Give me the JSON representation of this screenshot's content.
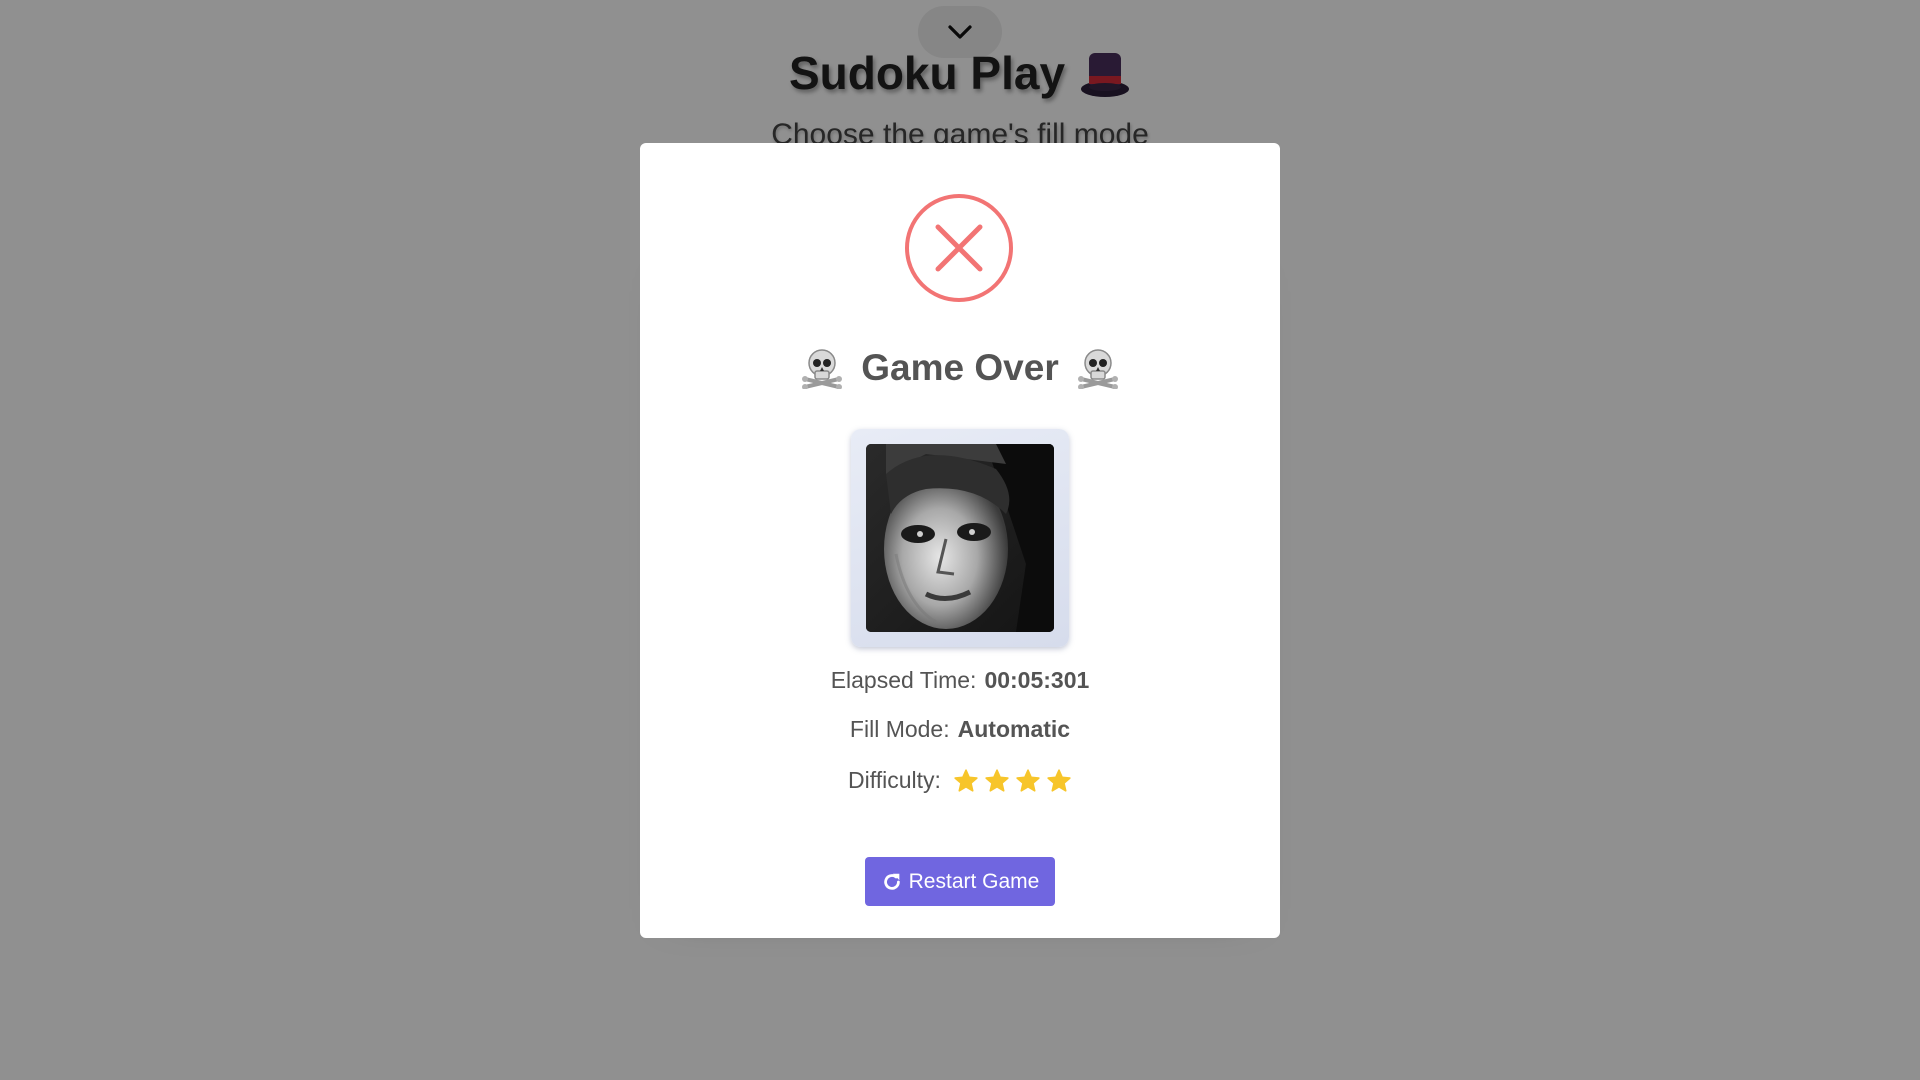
{
  "page": {
    "title": "Sudoku Play",
    "title_icon": "top-hat-icon",
    "subtitle": "Choose the game's fill mode",
    "collapse_icon": "chevron-down-icon"
  },
  "modal": {
    "status_icon": "error-x-icon",
    "title": "Game Over",
    "title_icons": [
      "skull-crossbones-icon",
      "skull-crossbones-icon"
    ],
    "image_description_icon": "game-over-portrait",
    "elapsed": {
      "label": "Elapsed Time:",
      "value": "00:05:301"
    },
    "fill_mode": {
      "label": "Fill Mode:",
      "value": "Automatic"
    },
    "difficulty": {
      "label": "Difficulty:",
      "stars": 4,
      "star_icon": "star-icon"
    },
    "restart_button": {
      "label": "Restart Game",
      "icon": "redo-icon"
    }
  },
  "colors": {
    "overlay": "#000000",
    "modal_text": "#545454",
    "error_red": "#f27474",
    "button_purple": "#7066e0",
    "star_yellow": "#f7c52a"
  }
}
